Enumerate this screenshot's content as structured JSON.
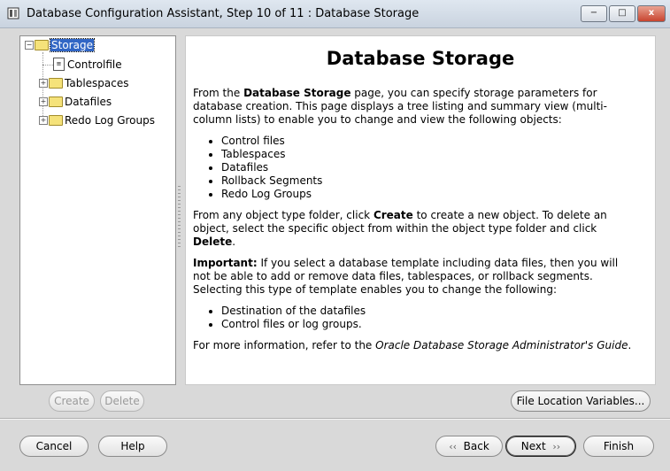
{
  "window": {
    "title": "Database Configuration Assistant, Step 10 of 11 : Database Storage",
    "minimize_label": "−",
    "maximize_label": "□",
    "close_label": "x"
  },
  "tree": {
    "root": "Storage",
    "items": [
      {
        "label": "Controlfile",
        "type": "file"
      },
      {
        "label": "Tablespaces",
        "type": "folder"
      },
      {
        "label": "Datafiles",
        "type": "folder"
      },
      {
        "label": "Redo Log Groups",
        "type": "folder"
      }
    ]
  },
  "content": {
    "title": "Database Storage",
    "intro_prefix": "From the ",
    "intro_bold": "Database Storage",
    "intro_suffix": " page, you can specify storage parameters for database creation. This page displays a tree listing and summary view (multi-column lists) to enable you to change and view the following objects:",
    "objects": [
      "Control files",
      "Tablespaces",
      "Datafiles",
      "Rollback Segments",
      "Redo Log Groups"
    ],
    "create_p1": "From any object type folder, click ",
    "create_bold": "Create",
    "create_p2": " to create a new object. To delete an object, select the specific object from within the object type folder and click ",
    "delete_bold": "Delete",
    "create_p3": ".",
    "important_bold": "Important:",
    "important_text": " If you select a database template including data files, then you will not be able to add or remove data files, tablespaces, or rollback segments. Selecting this type of template enables you to change the following:",
    "changes": [
      "Destination of the datafiles",
      "Control files or log groups."
    ],
    "more_prefix": "For more information, refer to the ",
    "more_italic": "Oracle Database Storage Administrator's Guide",
    "more_suffix": "."
  },
  "buttons": {
    "create": "Create",
    "delete": "Delete",
    "file_location": "File Location Variables...",
    "cancel": "Cancel",
    "help": "Help",
    "back": "Back",
    "next": "Next",
    "finish": "Finish"
  },
  "icons": {
    "app": "database-icon",
    "back": "back-arrow-icon",
    "next": "next-arrow-icon"
  }
}
